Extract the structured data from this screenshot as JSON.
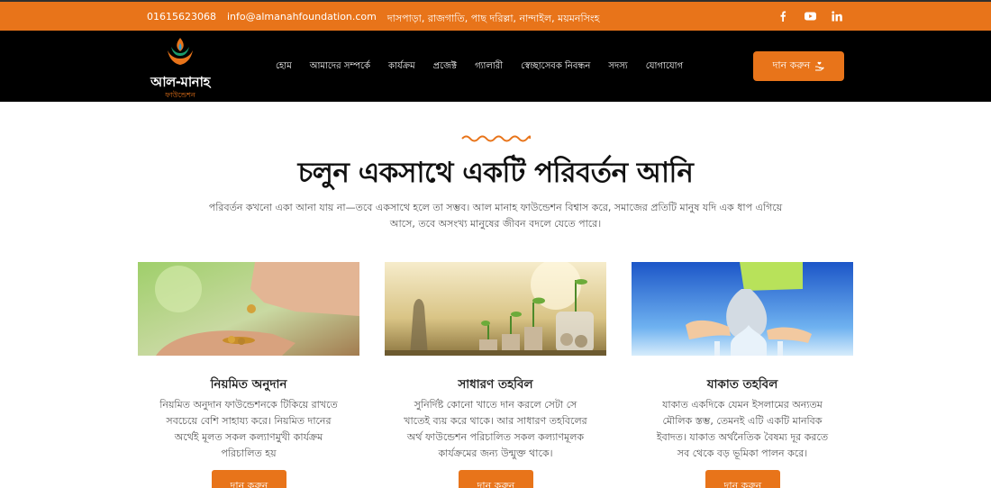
{
  "topbar": {
    "phone": "01615623068",
    "email": "info@almanahfoundation.com",
    "address": "দাসপাড়া, রাজগাতি, পাছ দরিল্লা, নান্দাইল, ময়মনসিংহ",
    "socials": [
      {
        "name": "facebook",
        "glyph": "f"
      },
      {
        "name": "youtube",
        "glyph": "▶"
      },
      {
        "name": "linkedin",
        "glyph": "in"
      }
    ]
  },
  "header": {
    "logo_name": "আল-মানাহ",
    "logo_sub": "ফাউন্ডেশন",
    "menu": [
      "হোম",
      "আমাদের সম্পর্কে",
      "কার্যক্রম",
      "প্রজেক্ট",
      "গ্যালারী",
      "স্বেচ্ছাসেবক নিবন্ধন",
      "সদস্য",
      "যোগাযোগ"
    ],
    "donate_label": "দান করুন"
  },
  "hero": {
    "title": "চলুন একসাথে একটি পরিবর্তন আনি",
    "intro": "পরিবর্তন কখনো একা আনা যায় না—তবে একসাথে হলে তা সম্ভব। আল মানাহ ফাউন্ডেশন বিশ্বাস করে, সমাজের প্রতিটি মানুষ যদি এক ধাপ এগিয়ে আসে, তবে অসংখ্য মানুষের জীবন বদলে যেতে পারে।"
  },
  "cards": [
    {
      "title": "নিয়মিত অনুদান",
      "desc": "নিয়মিত অনুদান ফাউন্ডেশনকে টিকিয়ে রাখতে সবচেয়ে বেশি সাহায্য করে। নিয়মিত দানের অর্থেই মূলত সকল কল্যাণমুখী কার্যক্রম পরিচালিত হয়",
      "button": "দান করুন"
    },
    {
      "title": "সাধারণ তহবিল",
      "desc": "সুনির্দিষ্ট কোনো খাতে দান করলে সেটা সে খাতেই ব্যয় করে থাকে। আর সাধারণ তহবিলের অর্থ ফাউন্ডেশন পরিচালিত সকল কল্যাণমূলক কার্যক্রমের জন্য উন্মুক্ত থাকে।",
      "button": "দান করুন"
    },
    {
      "title": "যাকাত তহবিল",
      "desc": "যাকাত একদিকে যেমন ইসলামের অন্যতম মৌলিক স্তম্ভ, তেমনই এটি একটি মানবিক ইবাদত। যাকাত অর্থনৈতিক বৈষম্য দূর করতে সব থেকে বড় ভূমিকা পালন করে।",
      "button": "দান করুন"
    }
  ],
  "colors": {
    "accent": "#e8741a",
    "nav_bg": "#000000",
    "text": "#222222",
    "muted": "#555555"
  }
}
